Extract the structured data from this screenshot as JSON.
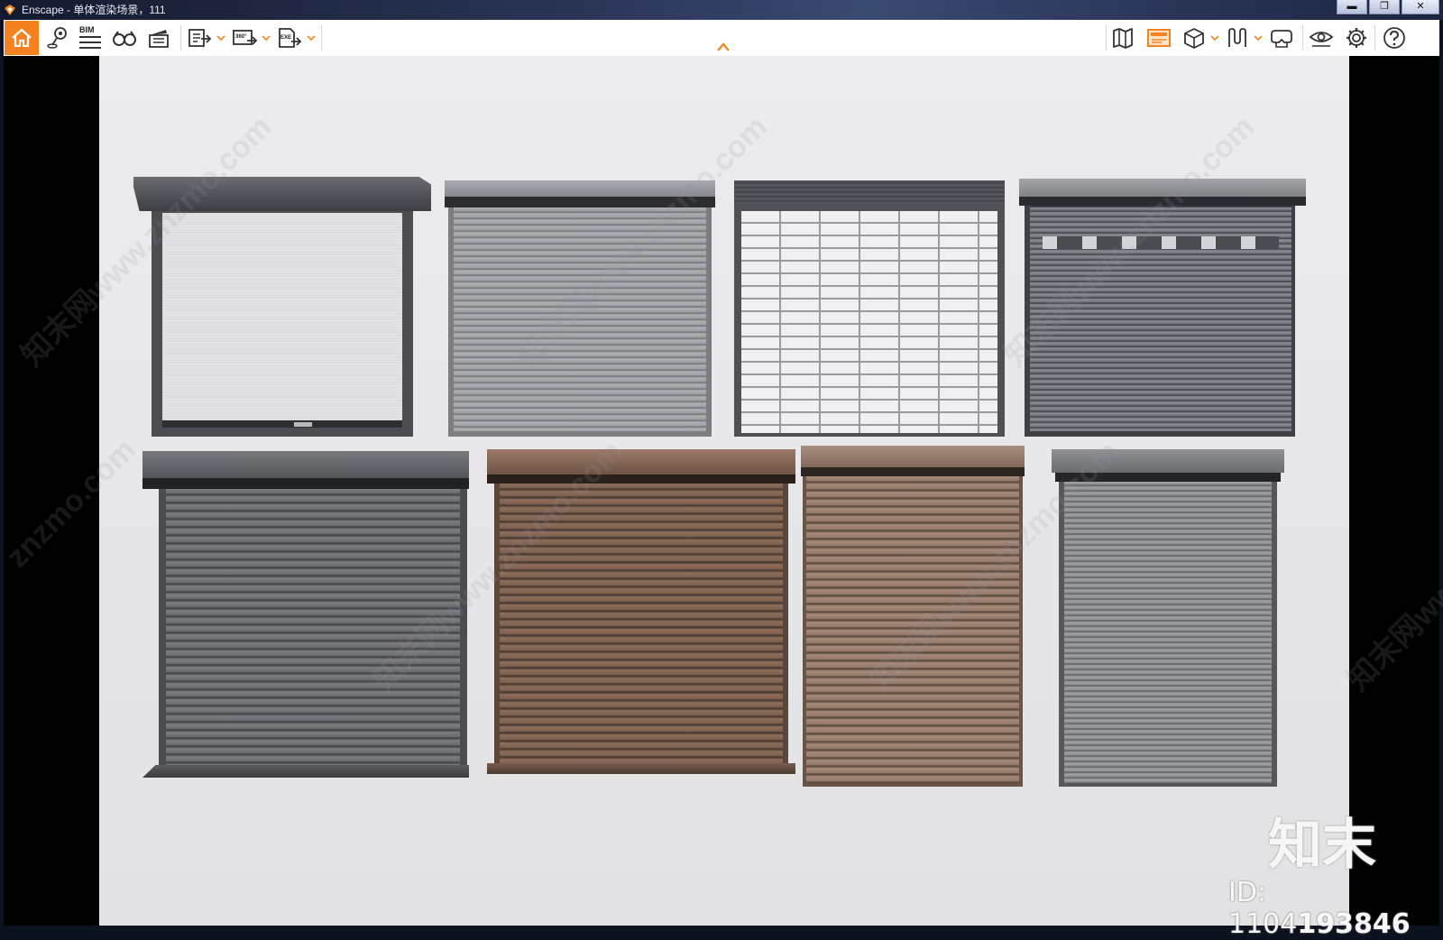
{
  "window": {
    "title": "Enscape - 单体渲染场景，111",
    "minimize_label": "▬",
    "maximize_label": "❐",
    "close_label": "✕"
  },
  "toolbar": {
    "left_tools": [
      {
        "name": "home",
        "icon": "home-icon"
      },
      {
        "name": "location",
        "icon": "map-pin-icon"
      },
      {
        "name": "bim",
        "icon": "bim-icon",
        "label": "BIM"
      },
      {
        "name": "views",
        "icon": "binoculars-icon"
      },
      {
        "name": "video-editor",
        "icon": "clapperboard-icon"
      },
      {
        "name": "batch-render",
        "icon": "export-batch-icon"
      },
      {
        "name": "panorama-export",
        "icon": "export-360-icon",
        "label": "360°"
      },
      {
        "name": "exe-export",
        "icon": "export-exe-icon",
        "label": "EXE"
      }
    ],
    "right_tools": [
      {
        "name": "minimap",
        "icon": "map-icon"
      },
      {
        "name": "capture-mode",
        "icon": "capture-icon",
        "active": true
      },
      {
        "name": "asset-library",
        "icon": "cube-icon"
      },
      {
        "name": "material-editor",
        "icon": "material-icon"
      },
      {
        "name": "vr",
        "icon": "vr-headset-icon"
      },
      {
        "name": "visual-settings",
        "icon": "eye-icon"
      },
      {
        "name": "settings",
        "icon": "gear-icon"
      },
      {
        "name": "help",
        "icon": "help-icon"
      }
    ],
    "accent_color": "#f58220"
  },
  "viewport": {
    "scene": "roller-shutter-set",
    "shutters": [
      {
        "name": "shutter-1",
        "style": "fine-stripe",
        "color": "#d9d9dc"
      },
      {
        "name": "shutter-2",
        "style": "slat",
        "color": "#9b9da2"
      },
      {
        "name": "shutter-3",
        "style": "brick-grille",
        "color": "#e7e7e9"
      },
      {
        "name": "shutter-4",
        "style": "slat-vented",
        "color": "#6c7079"
      },
      {
        "name": "shutter-5",
        "style": "slat",
        "color": "#6d6f73"
      },
      {
        "name": "shutter-6",
        "style": "slat",
        "color": "#7a5e4d"
      },
      {
        "name": "shutter-7",
        "style": "slat",
        "color": "#93786a"
      },
      {
        "name": "shutter-8",
        "style": "slat",
        "color": "#8b8d91"
      }
    ]
  },
  "overlay": {
    "watermark": "知末网www.znzmo.com",
    "watermark_short": "znzmo.com",
    "brand": "知末",
    "id_prefix": "ID: 1104",
    "id_suffix": "193846"
  }
}
